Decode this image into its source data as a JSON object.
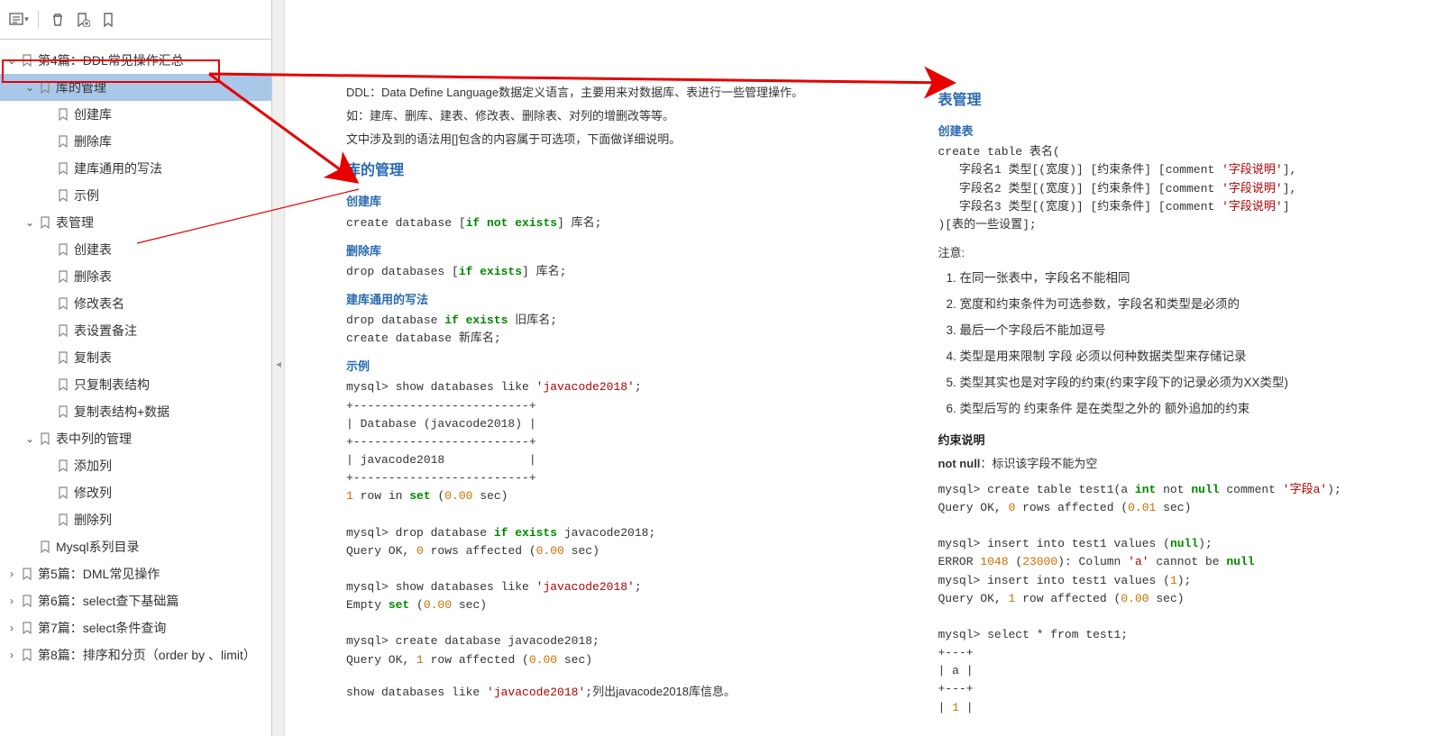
{
  "toolbar": {
    "options_icon": "options",
    "delete_icon": "delete",
    "add_bm_icon": "add-bookmark",
    "bm_icon": "bookmark"
  },
  "tree": [
    {
      "depth": 0,
      "exp": "open",
      "label": "第4篇：DDL常见操作汇总"
    },
    {
      "depth": 1,
      "exp": "open",
      "label": "库的管理",
      "selected": true
    },
    {
      "depth": 2,
      "exp": "",
      "label": "创建库"
    },
    {
      "depth": 2,
      "exp": "",
      "label": "删除库"
    },
    {
      "depth": 2,
      "exp": "",
      "label": "建库通用的写法"
    },
    {
      "depth": 2,
      "exp": "",
      "label": "示例"
    },
    {
      "depth": 1,
      "exp": "open",
      "label": "表管理"
    },
    {
      "depth": 2,
      "exp": "",
      "label": "创建表"
    },
    {
      "depth": 2,
      "exp": "",
      "label": "删除表"
    },
    {
      "depth": 2,
      "exp": "",
      "label": "修改表名"
    },
    {
      "depth": 2,
      "exp": "",
      "label": "表设置备注"
    },
    {
      "depth": 2,
      "exp": "",
      "label": "复制表"
    },
    {
      "depth": 2,
      "exp": "",
      "label": "只复制表结构"
    },
    {
      "depth": 2,
      "exp": "",
      "label": "复制表结构+数据"
    },
    {
      "depth": 1,
      "exp": "open",
      "label": "表中列的管理"
    },
    {
      "depth": 2,
      "exp": "",
      "label": "添加列"
    },
    {
      "depth": 2,
      "exp": "",
      "label": "修改列"
    },
    {
      "depth": 2,
      "exp": "",
      "label": "删除列"
    },
    {
      "depth": 1,
      "exp": "",
      "label": "Mysql系列目录"
    },
    {
      "depth": 0,
      "exp": "closed",
      "label": "第5篇：DML常见操作"
    },
    {
      "depth": 0,
      "exp": "closed",
      "label": "第6篇：select查下基础篇"
    },
    {
      "depth": 0,
      "exp": "closed",
      "label": "第7篇：select条件查询"
    },
    {
      "depth": 0,
      "exp": "closed",
      "label": "第8篇：排序和分页（order by 、limit）"
    }
  ],
  "left_page": {
    "intro1": "DDL：Data Define Language数据定义语言，主要用来对数据库、表进行一些管理操作。",
    "intro2": "如：建库、删库、建表、修改表、删除表、对列的增删改等等。",
    "intro3": "文中涉及到的语法用[]包含的内容属于可选项，下面做详细说明。",
    "h_lib": "库的管理",
    "h_create_db": "创建库",
    "create_db_code": "create database [if not exists] 库名;",
    "h_drop_db": "删除库",
    "drop_db_code": "drop databases [if exists] 库名;",
    "h_common": "建库通用的写法",
    "common_code": "drop database if exists 旧库名;\ncreate database 新库名;",
    "h_example": "示例",
    "example_code": "mysql> show databases like 'javacode2018';\n+-------------------------+\n| Database (javacode2018) |\n+-------------------------+\n| javacode2018            |\n+-------------------------+\n1 row in set (0.00 sec)\n\nmysql> drop database if exists javacode2018;\nQuery OK, 0 rows affected (0.00 sec)\n\nmysql> show databases like 'javacode2018';\nEmpty set (0.00 sec)\n\nmysql> create database javacode2018;\nQuery OK, 1 row affected (0.00 sec)",
    "example_tail": "show databases like 'javacode2018';列出javacode2018库信息。"
  },
  "right_page": {
    "h_table": "表管理",
    "h_create_table": "创建表",
    "create_table_code": "create table 表名(\n   字段名1 类型[(宽度)] [约束条件] [comment '字段说明'],\n   字段名2 类型[(宽度)] [约束条件] [comment '字段说明'],\n   字段名3 类型[(宽度)] [约束条件] [comment '字段说明']\n)[表的一些设置];",
    "h_note": "注意:",
    "notes": [
      "在同一张表中，字段名不能相同",
      "宽度和约束条件为可选参数，字段名和类型是必须的",
      "最后一个字段后不能加逗号",
      "类型是用来限制 字段 必须以何种数据类型来存储记录",
      "类型其实也是对字段的约束(约束字段下的记录必须为XX类型)",
      "类型后写的 约束条件 是在类型之外的 额外追加的约束"
    ],
    "h_constraint": "约束说明",
    "notnull_label": "not null",
    "notnull_desc": "：标识该字段不能为空",
    "nn_code": "mysql> create table test1(a int not null comment '字段a');\nQuery OK, 0 rows affected (0.01 sec)\n\nmysql> insert into test1 values (null);\nERROR 1048 (23000): Column 'a' cannot be null\nmysql> insert into test1 values (1);\nQuery OK, 1 row affected (0.00 sec)\n\nmysql> select * from test1;\n+---+\n| a |\n+---+\n| 1 |"
  }
}
